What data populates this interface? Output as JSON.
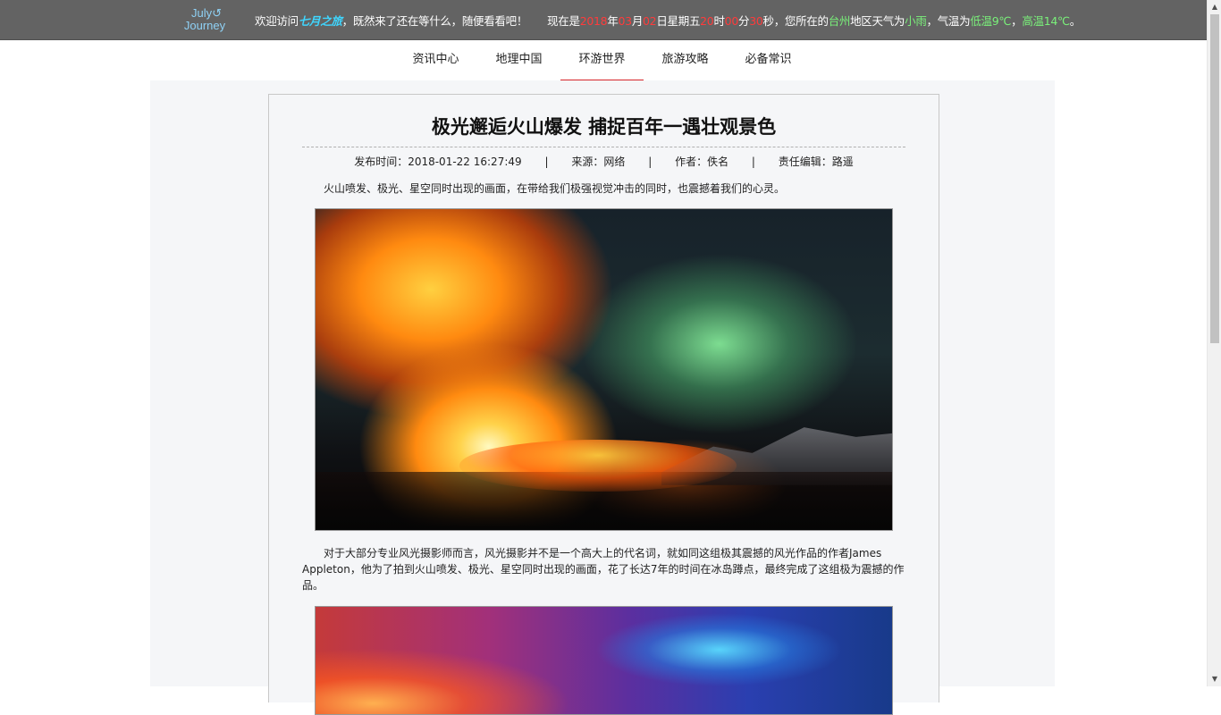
{
  "header": {
    "logo_line1": "July↺",
    "logo_line2": "Journey",
    "welcome_prefix": "欢迎访问",
    "site_name": "七月之旅",
    "welcome_suffix": "，既然来了还在等什么，随便看看吧！",
    "now_label": "现在是",
    "year": "2018",
    "month": "03",
    "day": "02",
    "weekday": "五",
    "hour": "20",
    "minute": "00",
    "second": "30",
    "loc_prefix": "秒，您所在的",
    "city": "台州",
    "weather_prefix": "地区天气为",
    "weather": "小雨",
    "temp_prefix": "，气温为",
    "low": "低温9℃",
    "comma": "，",
    "high": "高温14℃",
    "end": "。"
  },
  "nav": {
    "items": [
      "资讯中心",
      "地理中国",
      "环游世界",
      "旅游攻略",
      "必备常识"
    ],
    "active_index": 2
  },
  "article": {
    "title": "极光邂逅火山爆发 捕捉百年一遇壮观景色",
    "published": "发布时间：2018-01-22 16:27:49",
    "source": "来源：网络",
    "author": "作者：佚名",
    "editor": "责任编辑：路遥",
    "separator": "|",
    "intro": "火山喷发、极光、星空同时出现的画面，在带给我们极强视觉冲击的同时，也震撼着我们的心灵。",
    "body": "对于大部分专业风光摄影师而言，风光摄影并不是一个高大上的代名词，就如同这组极其震撼的风光作品的作者James Appleton，他为了拍到火山喷发、极光、星空同时出现的画面，花了长达7年的时间在冰岛蹲点，最终完成了这组极为震撼的作品。"
  },
  "colors": {
    "topbar": "#636363",
    "accent_red": "#d6262a",
    "site_name": "#3fd6ff",
    "highlight_green": "#7af07a"
  }
}
